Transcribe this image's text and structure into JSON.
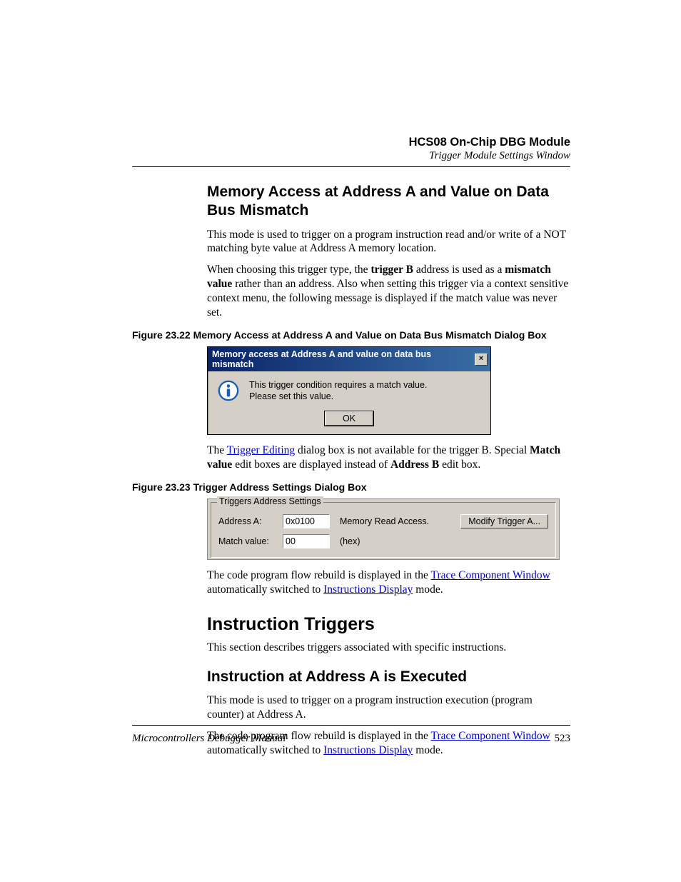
{
  "header": {
    "title": "HCS08 On-Chip DBG Module",
    "subtitle": "Trigger Module Settings Window"
  },
  "section1": {
    "heading": "Memory Access at Address A and Value on Data Bus Mismatch",
    "p1a": "This mode is used to trigger on a program instruction read and/or write of a NOT matching byte value at Address A memory location.",
    "p2_pre": "When choosing this trigger type, the ",
    "p2_b1": "trigger B",
    "p2_mid": " address is used as a ",
    "p2_b2": "mismatch value",
    "p2_post": " rather than an address. Also when setting this trigger via a context sensitive context menu, the following message is displayed if the match value was never set."
  },
  "fig22": {
    "caption": "Figure 23.22  Memory Access at Address A and Value on Data Bus Mismatch Dialog Box",
    "title": "Memory access at Address A and value on data bus mismatch",
    "line1": "This trigger condition requires a match value.",
    "line2": "Please set this value.",
    "ok": "OK",
    "close": "×"
  },
  "para3": {
    "pre": "The ",
    "link": "Trigger Editing",
    "mid": " dialog box is not available for the trigger B. Special ",
    "b1": "Match value",
    "mid2": " edit boxes are displayed instead of ",
    "b2": "Address B",
    "post": " edit box."
  },
  "fig23": {
    "caption": "Figure 23.23  Trigger Address Settings Dialog Box",
    "legend": "Triggers Address Settings",
    "addrA_label": "Address A:",
    "addrA_value": "0x0100",
    "access": "Memory Read Access.",
    "modify": "Modify Trigger A...",
    "match_label": "Match value:",
    "match_value": "00",
    "hex": "(hex)"
  },
  "para4": {
    "pre": "The code program flow rebuild is displayed in the ",
    "link1": "Trace Component Window",
    "mid": " automatically switched to ",
    "link2": "Instructions Display",
    "post": " mode."
  },
  "section2": {
    "heading": "Instruction Triggers",
    "p": "This section describes triggers associated with specific instructions."
  },
  "section3": {
    "heading": "Instruction at Address A is Executed",
    "p1": "This mode is used to trigger on a program instruction execution (program counter) at Address A.",
    "p2_pre": "The code program flow rebuild is displayed in the ",
    "p2_link1": "Trace Component Window",
    "p2_mid": " automatically switched to ",
    "p2_link2": "Instructions Display",
    "p2_post": " mode."
  },
  "footer": {
    "left": "Microcontrollers Debugger Manual",
    "right": "523"
  }
}
